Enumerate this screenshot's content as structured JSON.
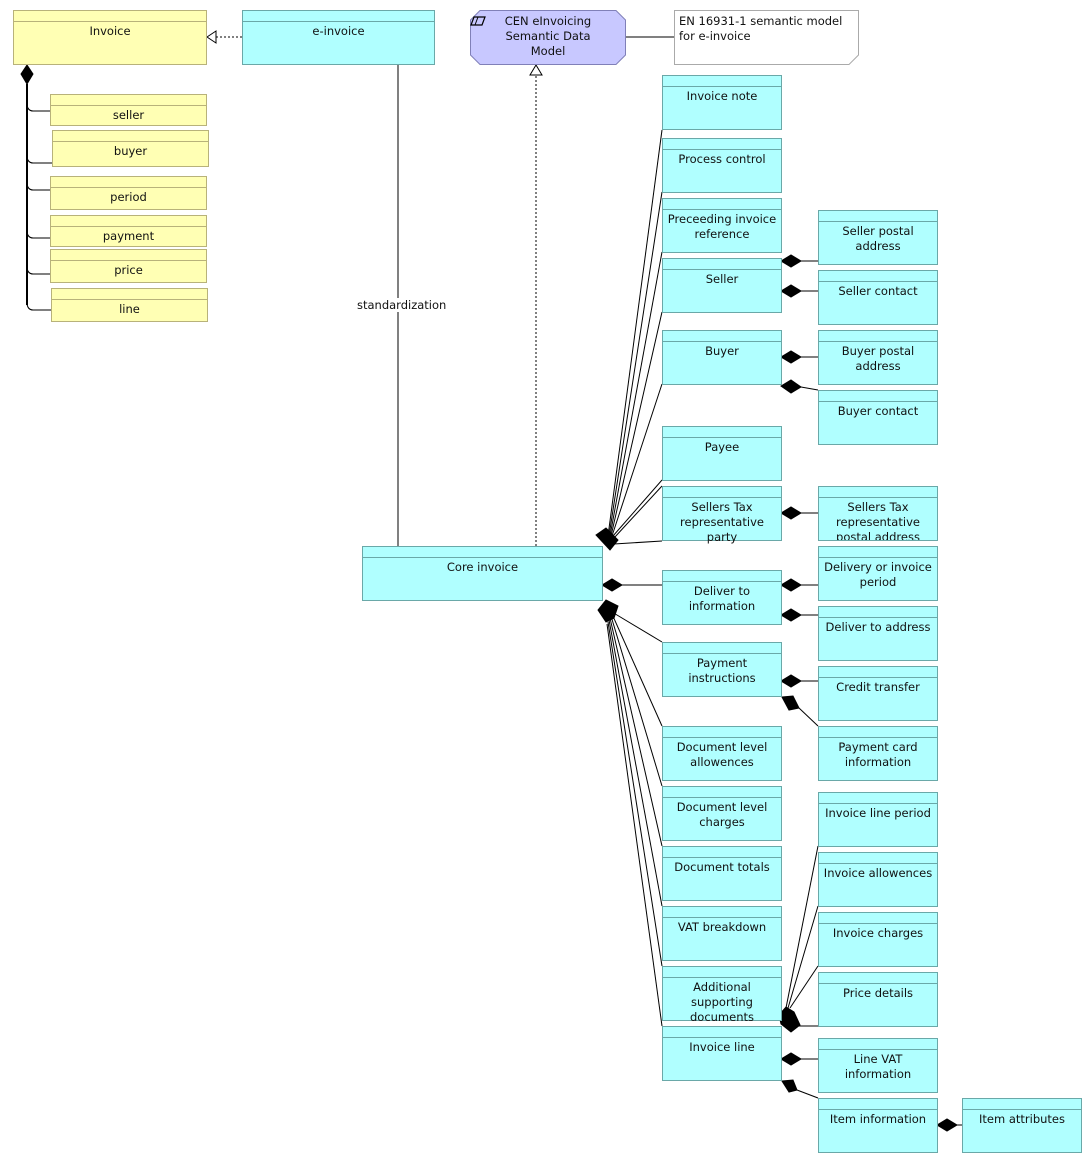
{
  "diagram": {
    "artifact": {
      "label": "CEN eInvoicing Semantic Data Model",
      "icon": "representation-icon"
    },
    "note": {
      "text": "EN 16931-1 semantic model for e-invoice"
    },
    "relation_labels": {
      "standardization": "standardization"
    },
    "classes": {
      "invoice": "Invoice",
      "seller_y": "seller",
      "buyer_y": "buyer",
      "period_y": "period",
      "payment_y": "payment",
      "price_y": "price",
      "line_y": "line",
      "e_invoice": "e-invoice",
      "core_invoice": "Core invoice",
      "invoice_note": "Invoice note",
      "process_control": "Process control",
      "preceeding_invoice_reference": "Preceeding invoice reference",
      "seller": "Seller",
      "seller_postal_address": "Seller postal address",
      "seller_contact": "Seller contact",
      "buyer": "Buyer",
      "buyer_postal_address": "Buyer postal address",
      "buyer_contact": "Buyer contact",
      "payee": "Payee",
      "sellers_tax_rep_party": "Sellers Tax representative party",
      "sellers_tax_rep_postal_address": "Sellers Tax representative postal address",
      "deliver_to_information": "Deliver to information",
      "delivery_or_invoice_period": "Delivery or invoice period",
      "deliver_to_address": "Deliver to address",
      "payment_instructions": "Payment instructions",
      "credit_transfer": "Credit transfer",
      "payment_card_information": "Payment card information",
      "document_level_allowences": "Document level allowences",
      "document_level_charges": "Document level charges",
      "document_totals": "Document totals",
      "vat_breakdown": "VAT breakdown",
      "additional_supporting_documents": "Additional supporting documents",
      "invoice_line": "Invoice line",
      "invoice_line_period": "Invoice line period",
      "invoice_allowences": "Invoice allowences",
      "invoice_charges": "Invoice charges",
      "price_details": "Price details",
      "line_vat_information": "Line VAT information",
      "item_information": "Item information",
      "item_attributes": "Item attributes"
    },
    "colors": {
      "business_object_yellow": "#ffffb4",
      "data_object_cyan": "#b0ffff",
      "artifact_purple": "#c8c8ff",
      "line": "#000000"
    }
  }
}
